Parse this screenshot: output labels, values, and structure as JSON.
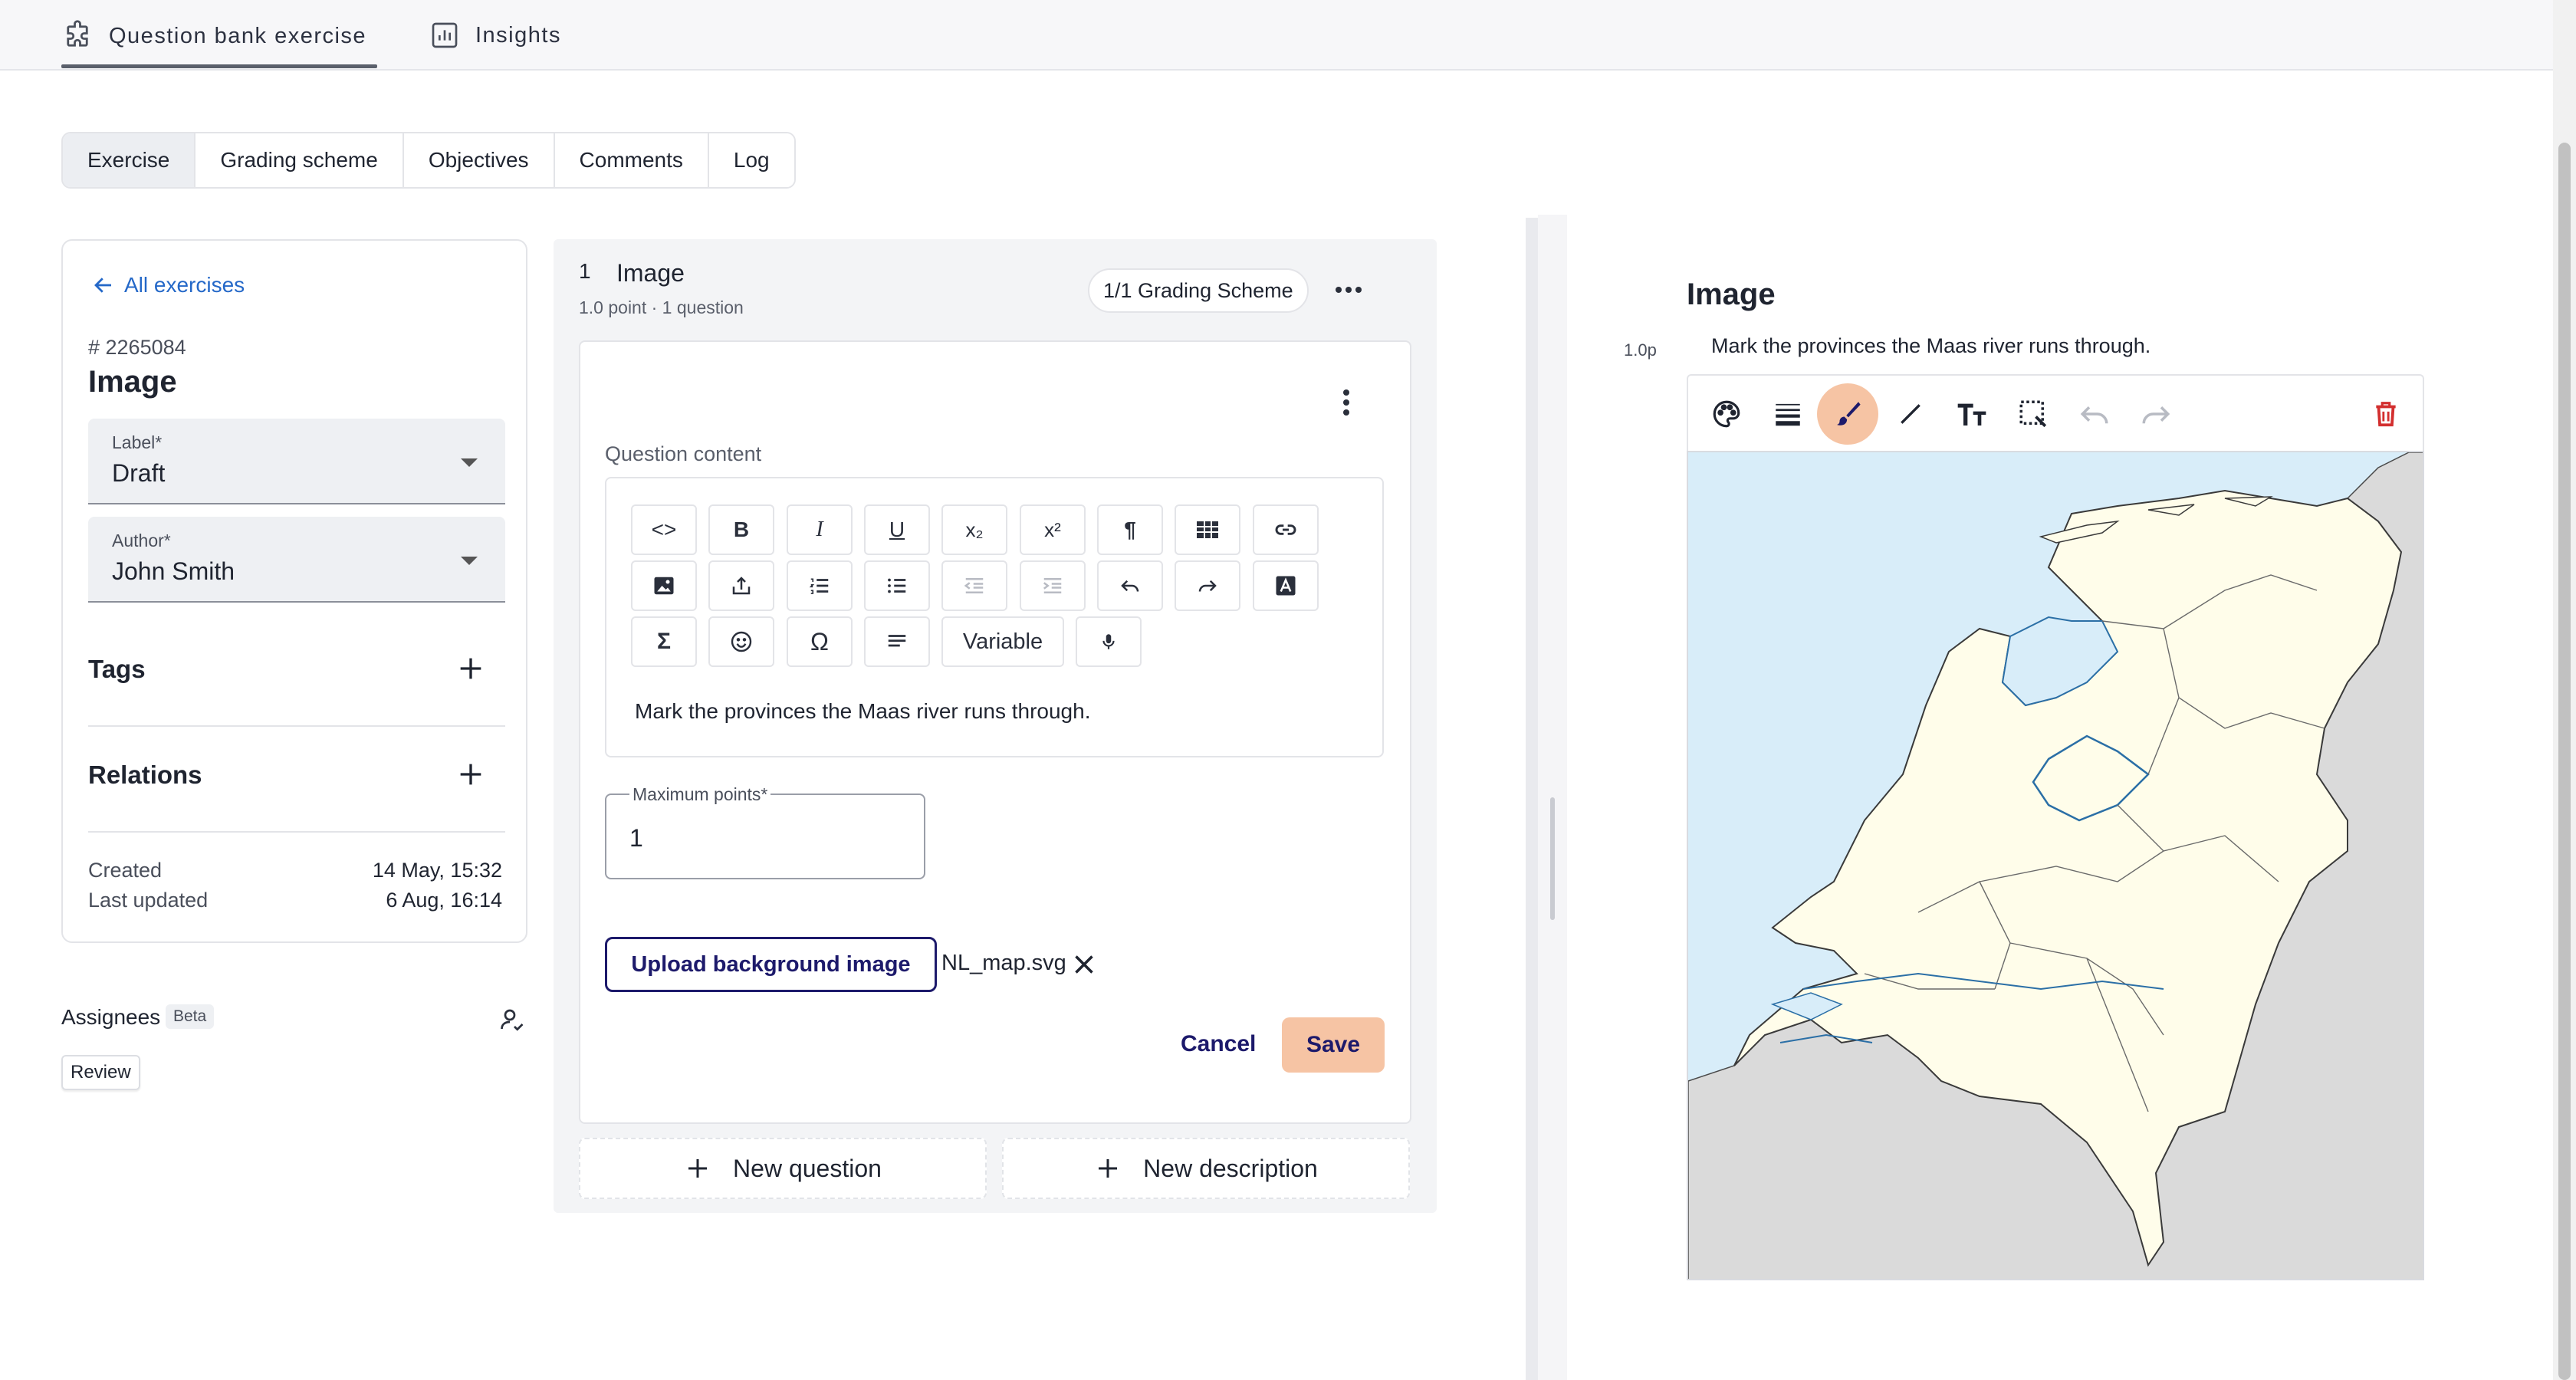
{
  "topbar": {
    "tabs": [
      {
        "label": "Question bank exercise",
        "icon": "puzzle-icon",
        "active": true
      },
      {
        "label": "Insights",
        "icon": "bar-chart-icon",
        "active": false
      }
    ]
  },
  "exercise_tabs": [
    {
      "label": "Exercise",
      "active": true
    },
    {
      "label": "Grading scheme"
    },
    {
      "label": "Objectives"
    },
    {
      "label": "Comments"
    },
    {
      "label": "Log"
    }
  ],
  "sidebar": {
    "back_link": "All exercises",
    "exercise_id": "# 2265084",
    "title": "Image",
    "label_field": {
      "label": "Label*",
      "value": "Draft"
    },
    "author_field": {
      "label": "Author*",
      "value": "John Smith"
    },
    "tags_heading": "Tags",
    "relations_heading": "Relations",
    "created_label": "Created",
    "created_value": "14 May, 15:32",
    "updated_label": "Last updated",
    "updated_value": "6 Aug, 16:14",
    "assignees_label": "Assignees",
    "beta_badge": "Beta",
    "review_chip": "Review"
  },
  "question": {
    "number": "1",
    "title": "Image",
    "meta": "1.0 point · 1 question",
    "grading_scheme_chip": "1/1 Grading Scheme",
    "content_label": "Question content",
    "toolbar": {
      "row1": [
        "<>",
        "B",
        "I",
        "U",
        "x₂",
        "x²",
        "¶",
        "table",
        "link"
      ],
      "variable_label": "Variable"
    },
    "content_text": "Mark the provinces the Maas river runs through.",
    "max_points_label": "Maximum points*",
    "max_points_value": "1",
    "upload_label": "Upload background image",
    "file_name": "NL_map.svg",
    "cancel_label": "Cancel",
    "save_label": "Save"
  },
  "actions": {
    "new_question": "New question",
    "new_description": "New description"
  },
  "preview": {
    "title": "Image",
    "points": "1.0p",
    "question_text": "Mark the provinces the Maas river runs through.",
    "active_tool": "brush",
    "colors": {
      "active_tool_bg": "#f6c4a4",
      "delete": "#d32f2f",
      "water": "#d8edf9",
      "land": "#fffdea",
      "foreign": "#dadada"
    }
  },
  "colors": {
    "brand": "#1d1a6b",
    "save_bg": "#f6c4a4",
    "link": "#2468c8"
  }
}
